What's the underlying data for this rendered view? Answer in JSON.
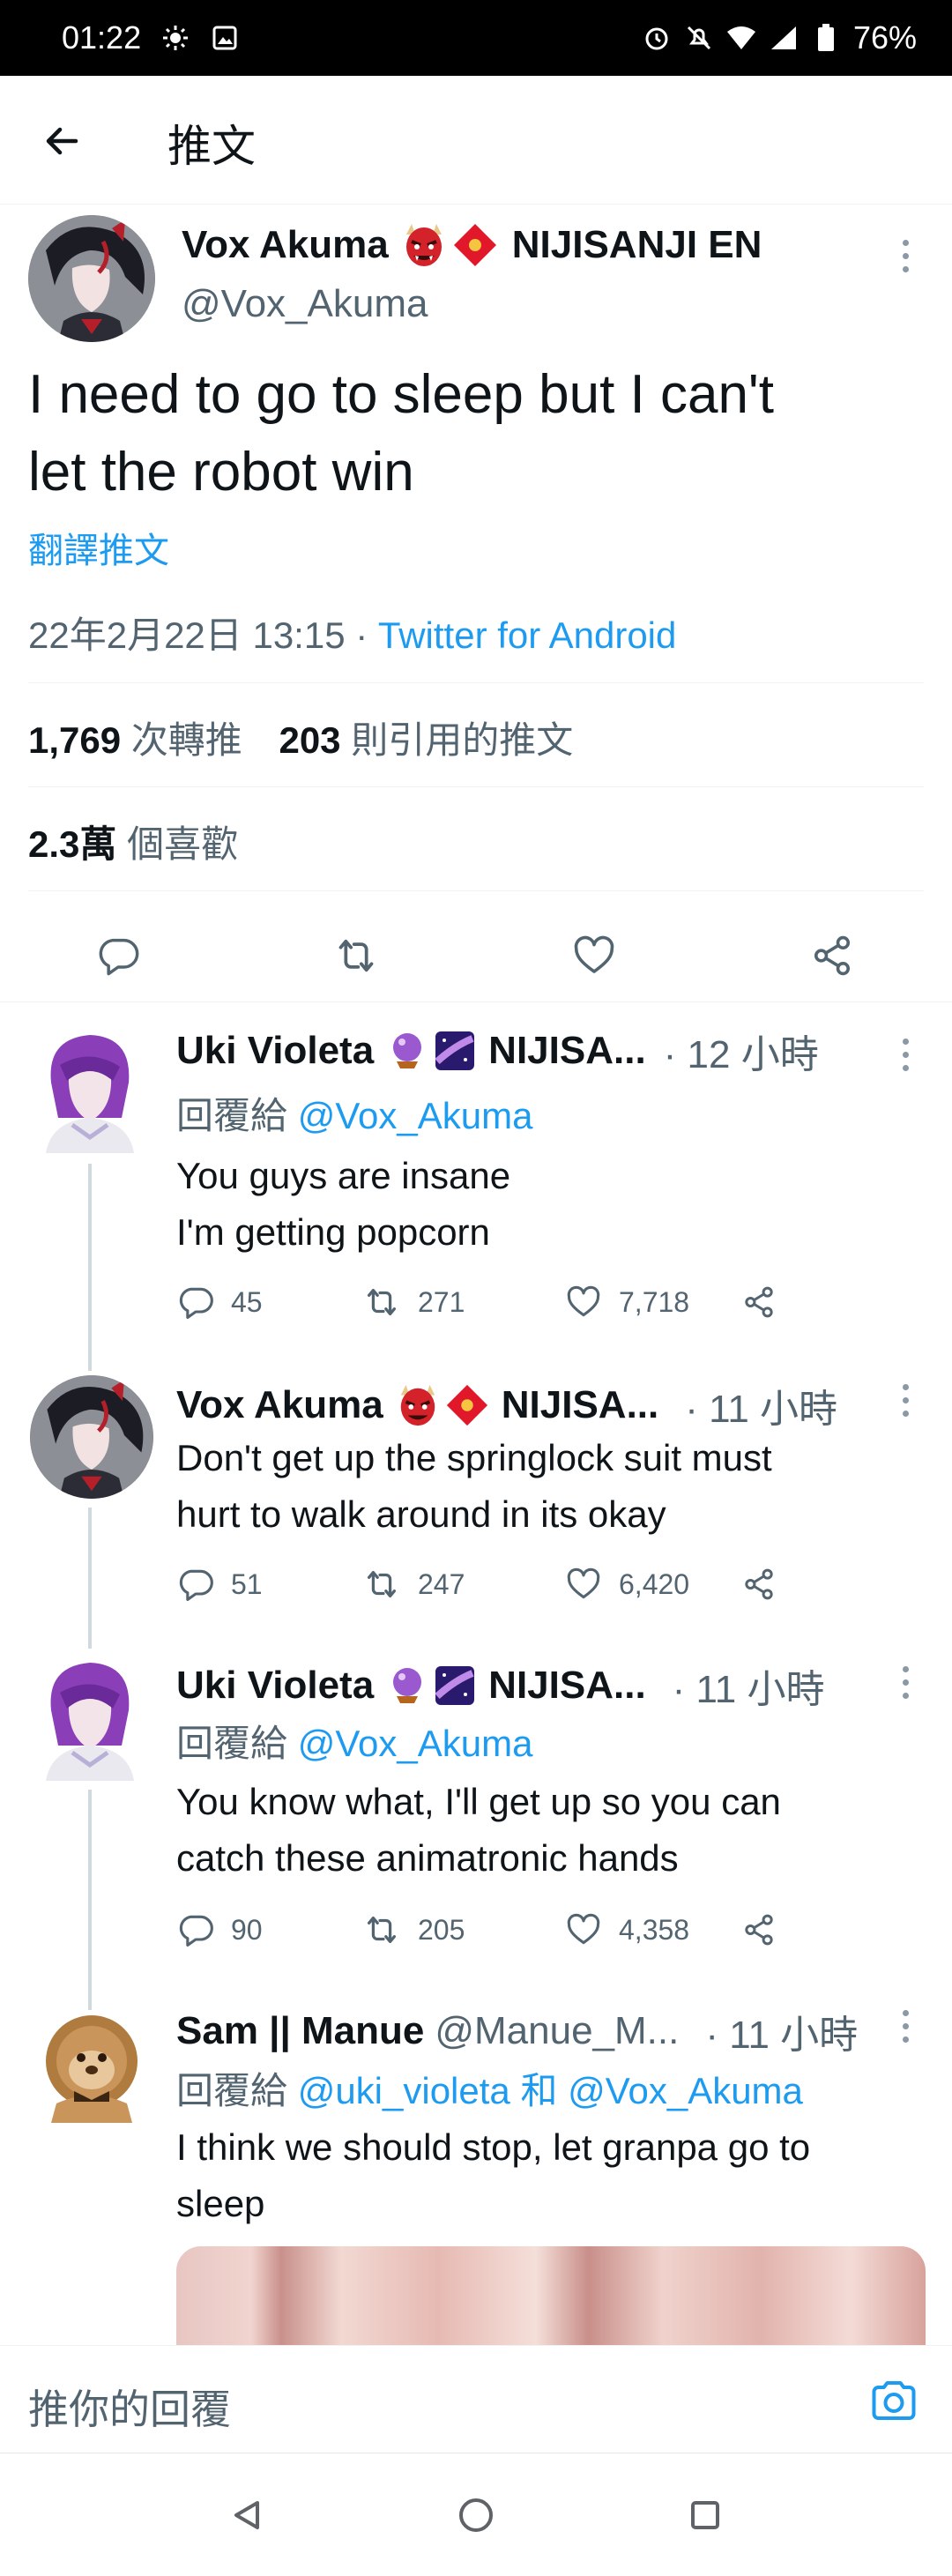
{
  "status_bar": {
    "time": "01:22",
    "battery": "76%",
    "icons": [
      "brightness-icon",
      "image-icon",
      "alarm-icon",
      "mute-icon",
      "wifi-icon",
      "signal-icon",
      "battery-icon"
    ]
  },
  "header": {
    "title": "推文",
    "back_icon": "arrow-left-icon"
  },
  "main_tweet": {
    "name": "Vox Akuma",
    "badge_text": "NIJISANJI EN",
    "handle": "@Vox_Akuma",
    "text_line1": "I need to go to sleep but I can't",
    "text_line2": "let the robot win",
    "translate": "翻譯推文",
    "date": "22年2月22日 13:15 · ",
    "source": "Twitter for Android",
    "retweets_count": "1,769",
    "retweets_label": "次轉推",
    "quotes_count": "203",
    "quotes_label": "則引用的推文",
    "likes_count": "2.3萬",
    "likes_label": "個喜歡"
  },
  "replies": [
    {
      "name": "Uki Violeta",
      "badge_text": "NIJISA...",
      "time": "· 12 小時",
      "reply_prefix": "回覆給",
      "reply_to": "@Vox_Akuma",
      "line1": "You guys are insane",
      "line2": "I'm getting popcorn",
      "replies": "45",
      "retweets": "271",
      "likes": "7,718"
    },
    {
      "name": "Vox Akuma",
      "badge_text": "NIJISA...",
      "time": "· 11 小時",
      "line1": "Don't get up the springlock suit must",
      "line2": "hurt to walk around in its okay",
      "replies": "51",
      "retweets": "247",
      "likes": "6,420"
    },
    {
      "name": "Uki Violeta",
      "badge_text": "NIJISA...",
      "time": "· 11 小時",
      "reply_prefix": "回覆給",
      "reply_to": "@Vox_Akuma",
      "line1": "You know what, I'll get up so you can",
      "line2": "catch these animatronic hands",
      "replies": "90",
      "retweets": "205",
      "likes": "4,358"
    },
    {
      "name": "Sam || Manue",
      "handle": "@Manue_M...",
      "time": "· 11 小時",
      "reply_prefix": "回覆給",
      "reply_to": "@uki_violeta",
      "reply_and": "和",
      "reply_to2": "@Vox_Akuma",
      "line1": "I think we should stop, let granpa go to",
      "line2": "sleep"
    }
  ],
  "composer": {
    "placeholder": "推你的回覆"
  },
  "colors": {
    "link": "#1d9bf0",
    "secondary": "#536471",
    "text": "#0f1419"
  }
}
